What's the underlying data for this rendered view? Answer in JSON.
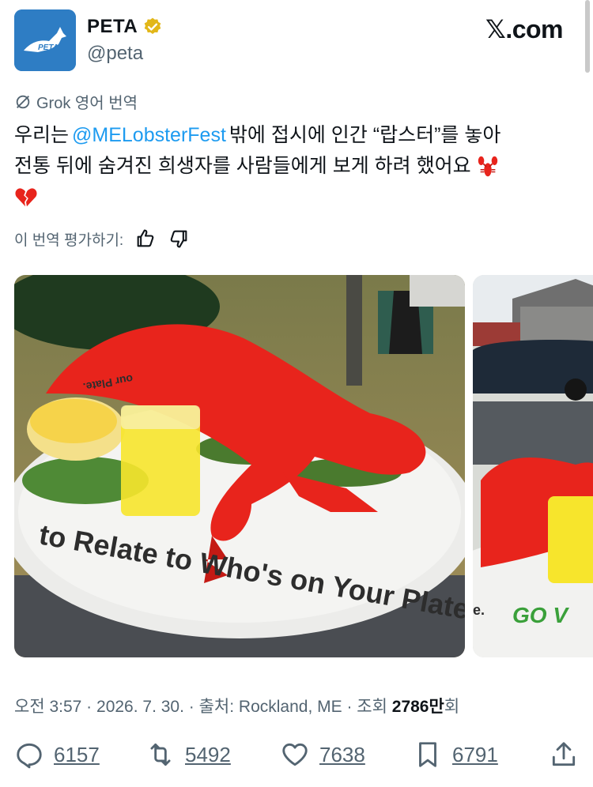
{
  "account": {
    "name": "PETA",
    "handle": "@peta",
    "avatar_text": "PETA"
  },
  "brand": "𝕏.com",
  "translation": {
    "label": "Grok 영어 번역"
  },
  "tweet": {
    "line1_pre": "우리는 ",
    "mention": "@MELobsterFest",
    "line1_post": " 밖에 접시에 인간 “랍스터”를 놓아",
    "line2": "전통 뒤에 숨겨진 희생자를 사람들에게 보게 하려 했어요"
  },
  "rating": {
    "label": "이 번역 평가하기:"
  },
  "media": {
    "plate_text": "to Relate to Who's on Your Plate.",
    "plate_text_top": "our Plate.",
    "plate_text_side": "GO V",
    "plate_text_side2": "e."
  },
  "meta": {
    "time_date_source": "오전 3:57 · 2026. 7. 30. · 출처: Rockland, ME · 조회 ",
    "views_number": "2786만",
    "views_unit": "회"
  },
  "stats": {
    "replies": "6157",
    "reposts": "5492",
    "likes": "7638",
    "bookmarks": "6791"
  },
  "colors": {
    "mention": "#1d9bf0",
    "secondary_text": "#536471",
    "avatar_bg": "#2e7dc4",
    "verified_gold": "#e2b719",
    "lobster_red": "#e8241c"
  },
  "icons": [
    "verified-badge-icon",
    "grok-icon",
    "thumbs-up-icon",
    "thumbs-down-icon",
    "reply-icon",
    "repost-icon",
    "like-icon",
    "bookmark-icon",
    "share-icon",
    "lobster-emoji-icon",
    "broken-heart-emoji-icon"
  ]
}
